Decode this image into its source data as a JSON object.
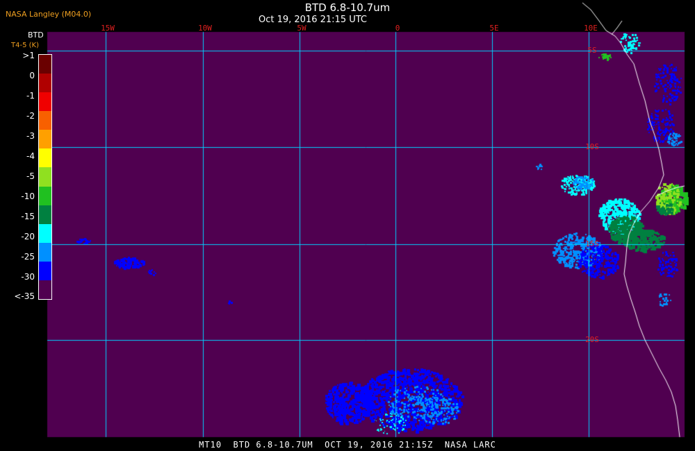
{
  "header": {
    "producer": "NASA Langley (M04.0)",
    "title": "BTD 6.8-10.7um",
    "timestamp": "Oct 19, 2016 21:15 UTC"
  },
  "colorbar": {
    "title": "BTD",
    "unit": "T4-5 (K)",
    "labels": [
      ">1",
      "0",
      "-1",
      "-2",
      "-3",
      "-4",
      "-5",
      "-10",
      "-15",
      "-20",
      "-25",
      "-30",
      "<-35"
    ],
    "colors": [
      "#6a0000",
      "#b00000",
      "#f00000",
      "#f86000",
      "#ffa000",
      "#ffff00",
      "#90e020",
      "#20c020",
      "#008040",
      "#00ffff",
      "#0090ff",
      "#0000ff",
      "#500050"
    ]
  },
  "map": {
    "background_color": "#500050",
    "grid_color": "#00d0ff",
    "coast_color": "#ffffff",
    "lon_labels": [
      "15W",
      "10W",
      "5W",
      "0",
      "5E",
      "10E"
    ],
    "lat_labels": [
      "5S",
      "10S",
      "15S",
      "20S"
    ]
  },
  "footer": {
    "text": "MT10  BTD 6.8-10.7UM  OCT 19, 2016 21:15Z  NASA LARC"
  }
}
